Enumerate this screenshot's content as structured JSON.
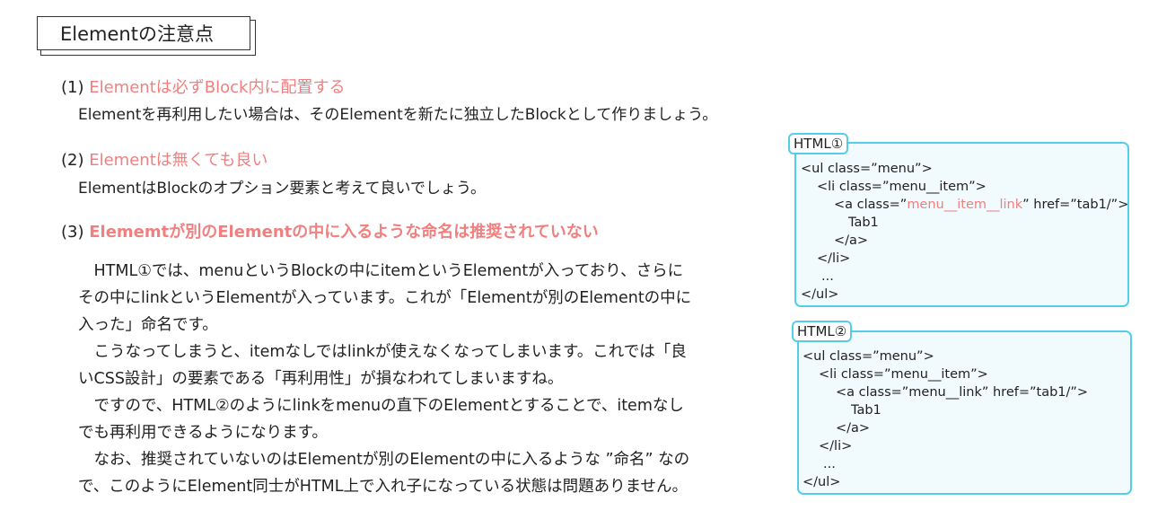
{
  "title": "Elementの注意点",
  "sections": [
    {
      "number": "(1)",
      "heading": "Elementは必ずBlock内に配置する",
      "description": "Elementを再利用したい場合は、そのElementを新たに独立したBlockとして作りましょう。"
    },
    {
      "number": "(2)",
      "heading": "Elementは無くても良い",
      "description": "ElementはBlockのオプション要素と考えて良いでしょう。"
    },
    {
      "number": "(3)",
      "heading": "Elememtが別のElementの中に入るような命名は推奨されていない",
      "paragraph_lines": [
        "　HTML①では、menuというBlockの中にitemというElementが入っており、さらに",
        "その中にlinkというElementが入っています。これが「Elementが別のElementの中に",
        "入った」命名です。",
        "　こうなってしまうと、itemなしではlinkが使えなくなってしまいます。これでは「良",
        "いCSS設計」の要素である「再利用性」が損なわれてしまいますね。",
        "　ですので、HTML②のようにlinkをmenuの直下のElementとすることで、itemなし",
        "でも再利用できるようになります。",
        "　なお、推奨されていないのはElementが別のElementの中に入るような ”命名” なの",
        "で、このようにElement同士がHTML上で入れ子になっている状態は問題ありません。"
      ]
    }
  ],
  "code_examples": [
    {
      "label": "HTML①",
      "lines": [
        "<ul class=”menu”>",
        "<li class=”menu__item”>",
        "<a class=”",
        "menu__item__link",
        "” href=”tab1/”>",
        "Tab1",
        "</a>",
        "</li>",
        "...",
        "</ul>"
      ]
    },
    {
      "label": "HTML②",
      "lines": [
        "<ul class=”menu”>",
        "<li class=”menu__item”>",
        "<a class=”menu__link” href=”tab1/”>",
        "Tab1",
        "</a>",
        "</li>",
        "...",
        "</ul>"
      ]
    }
  ],
  "colors": {
    "accent_pink": "#f08080",
    "code_border": "#56cceb",
    "code_background": "#f1fafd"
  }
}
